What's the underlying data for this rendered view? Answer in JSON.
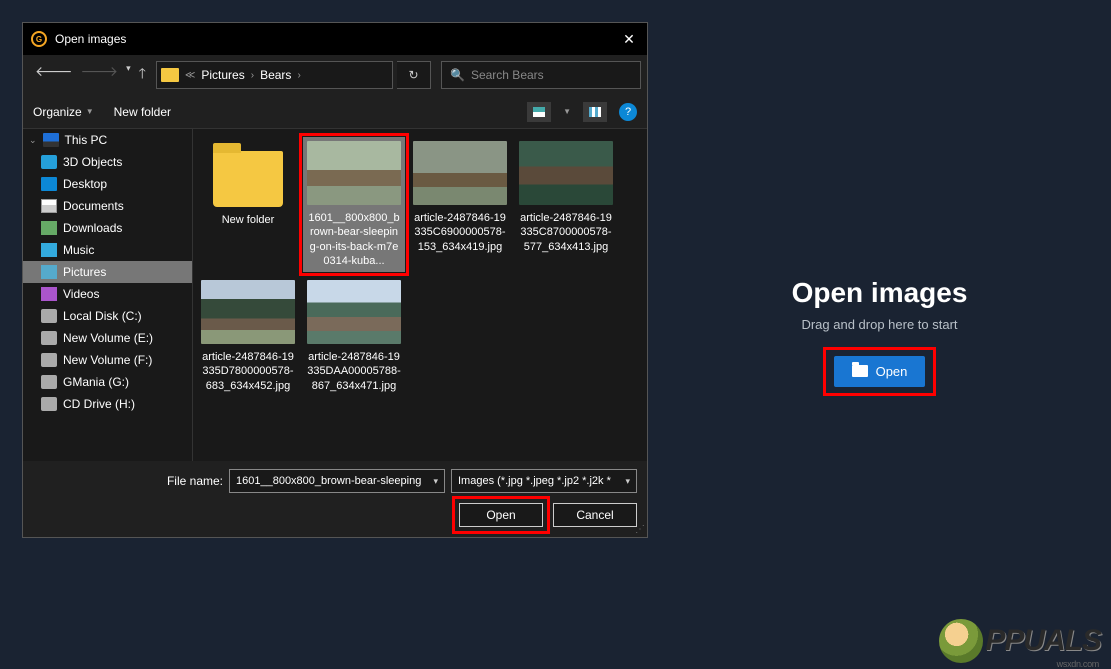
{
  "dialog": {
    "title": "Open images",
    "breadcrumb": {
      "folder1": "Pictures",
      "folder2": "Bears"
    },
    "search_placeholder": "Search Bears",
    "toolbar": {
      "organize": "Organize",
      "new_folder": "New folder"
    },
    "sidebar": {
      "this_pc": "This PC",
      "items": [
        "3D Objects",
        "Desktop",
        "Documents",
        "Downloads",
        "Music",
        "Pictures",
        "Videos",
        "Local Disk (C:)",
        "New Volume (E:)",
        "New Volume (F:)",
        "GMania (G:)",
        "CD Drive (H:)"
      ]
    },
    "files": [
      {
        "name": "New folder"
      },
      {
        "name": "1601__800x800_brown-bear-sleeping-on-its-back-m7e0314-kuba..."
      },
      {
        "name": "article-2487846-19335C6900000578-153_634x419.jpg"
      },
      {
        "name": "article-2487846-19335C8700000578-577_634x413.jpg"
      },
      {
        "name": "article-2487846-19335D7800000578-683_634x452.jpg"
      },
      {
        "name": "article-2487846-19335DAA00005788-867_634x471.jpg"
      }
    ],
    "footer": {
      "filename_label": "File name:",
      "filename_value": "1601__800x800_brown-bear-sleeping",
      "filetype_value": "Images (*.jpg *.jpeg *.jp2 *.j2k *",
      "open": "Open",
      "cancel": "Cancel"
    }
  },
  "right": {
    "title": "Open images",
    "subtitle": "Drag and drop here to start",
    "open_btn": "Open"
  },
  "watermark": {
    "text": "PPUALS",
    "sub": "wsxdn.com"
  }
}
